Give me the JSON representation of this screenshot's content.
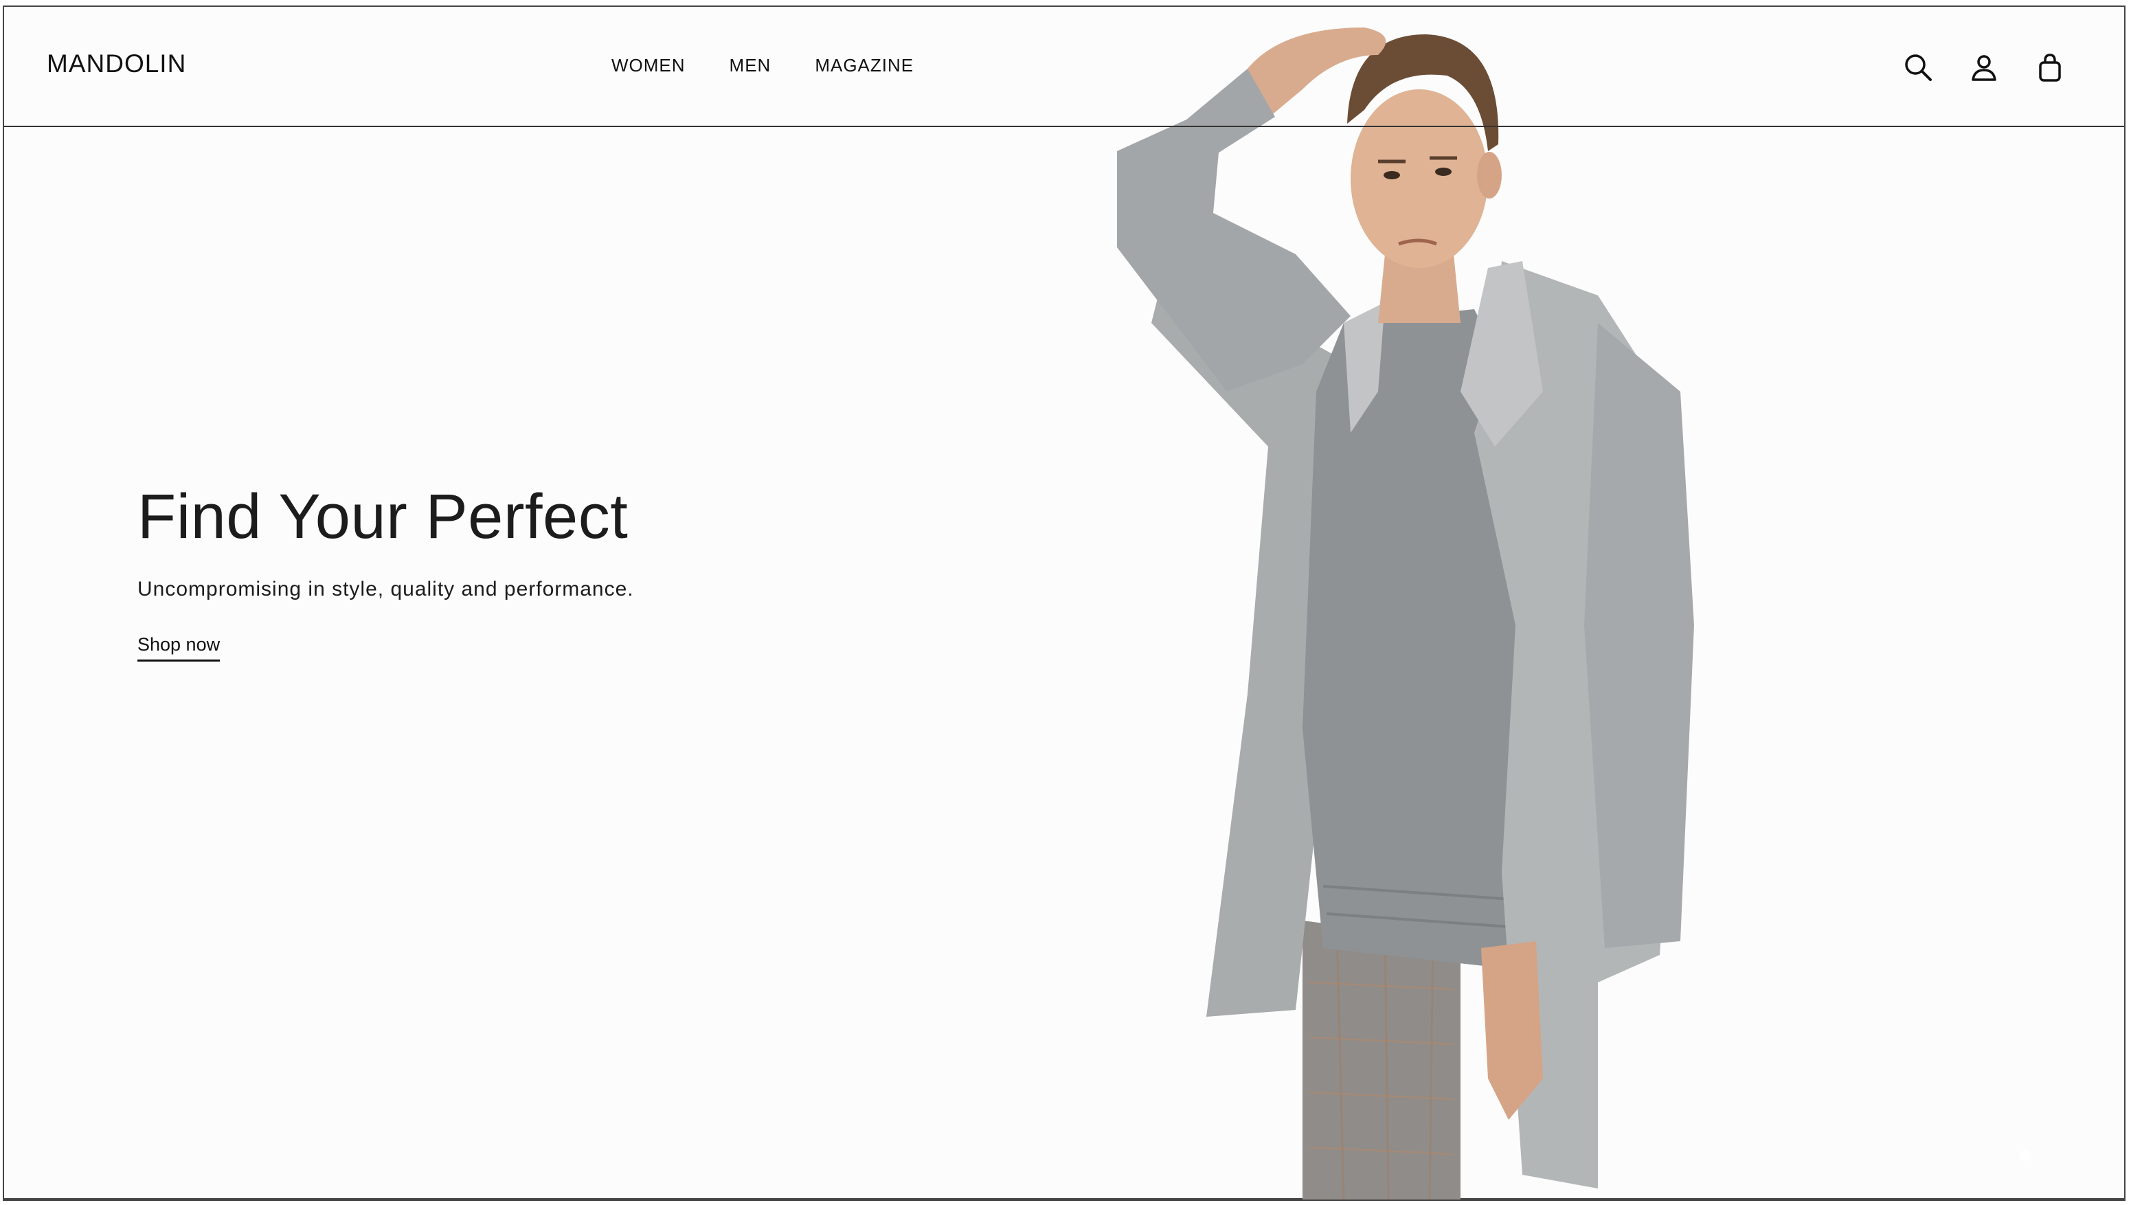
{
  "header": {
    "logo": "MANDOLIN",
    "nav": [
      {
        "label": "WOMEN"
      },
      {
        "label": "MEN"
      },
      {
        "label": "MAGAZINE"
      }
    ],
    "icons": [
      "search-icon",
      "account-icon",
      "bag-icon"
    ]
  },
  "hero": {
    "title": "Find Your Perfect",
    "subtitle": "Uncompromising in style, quality and performance.",
    "cta": "Shop now"
  },
  "colors": {
    "background": "#fcfcfc",
    "text": "#1c1c1c",
    "coat": "#a9acad",
    "sweater": "#8e9294",
    "skin": "#d9ab8e",
    "hair": "#6b4c35",
    "pants": "#8f8c8a"
  }
}
